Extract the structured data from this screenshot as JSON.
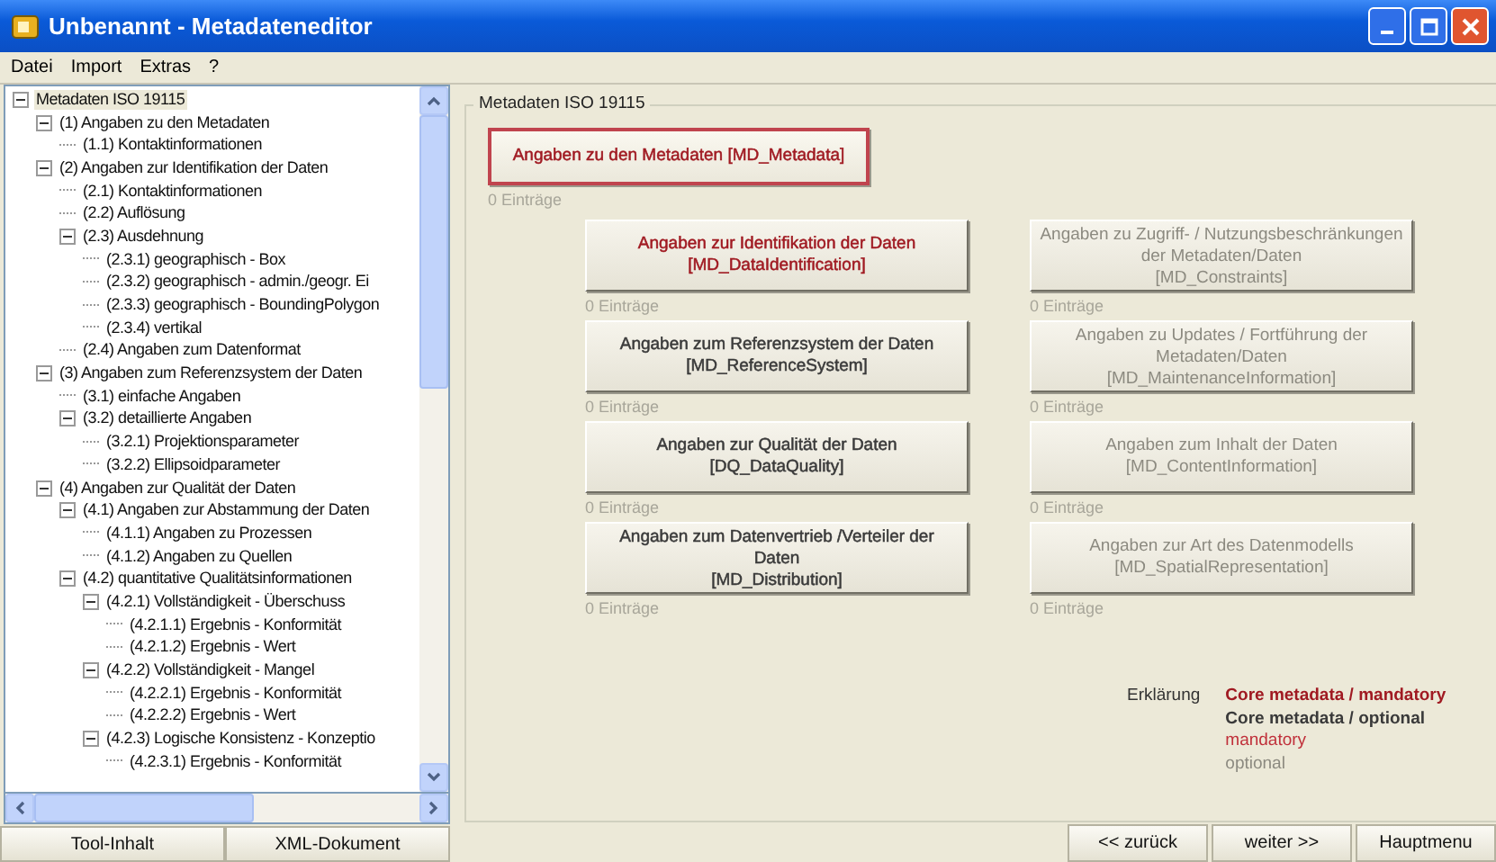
{
  "window": {
    "title": "Unbenannt - Metadateneditor"
  },
  "menu": [
    "Datei",
    "Import",
    "Extras",
    "?"
  ],
  "tree": [
    {
      "label": "Metadaten ISO 19115",
      "selected": true,
      "expanded": true,
      "children": [
        {
          "label": "(1) Angaben zu den Metadaten",
          "selected": false,
          "expanded": true,
          "children": [
            {
              "label": "(1.1) Kontaktinformationen",
              "selected": false
            }
          ]
        },
        {
          "label": "(2) Angaben zur Identifikation der Daten",
          "selected": false,
          "expanded": true,
          "children": [
            {
              "label": "(2.1) Kontaktinformationen",
              "selected": false
            },
            {
              "label": "(2.2) Auflösung",
              "selected": false
            },
            {
              "label": "(2.3) Ausdehnung",
              "selected": false,
              "expanded": true,
              "children": [
                {
                  "label": "(2.3.1) geographisch - Box",
                  "selected": false
                },
                {
                  "label": "(2.3.2) geographisch - admin./geogr. Ei",
                  "selected": false
                },
                {
                  "label": "(2.3.3) geographisch - BoundingPolygon",
                  "selected": false
                },
                {
                  "label": "(2.3.4) vertikal",
                  "selected": false
                }
              ]
            },
            {
              "label": "(2.4) Angaben zum Datenformat",
              "selected": false
            }
          ]
        },
        {
          "label": "(3) Angaben zum Referenzsystem der Daten",
          "selected": false,
          "expanded": true,
          "children": [
            {
              "label": "(3.1) einfache Angaben",
              "selected": false
            },
            {
              "label": "(3.2) detaillierte Angaben",
              "selected": false,
              "expanded": true,
              "children": [
                {
                  "label": "(3.2.1) Projektionsparameter",
                  "selected": false
                },
                {
                  "label": "(3.2.2) Ellipsoidparameter",
                  "selected": false
                }
              ]
            }
          ]
        },
        {
          "label": "(4) Angaben zur Qualität der Daten",
          "selected": false,
          "expanded": true,
          "children": [
            {
              "label": "(4.1) Angaben zur Abstammung der Daten",
              "selected": false,
              "expanded": true,
              "children": [
                {
                  "label": "(4.1.1) Angaben zu Prozessen",
                  "selected": false
                },
                {
                  "label": "(4.1.2) Angaben zu Quellen",
                  "selected": false
                }
              ]
            },
            {
              "label": "(4.2) quantitative Qualitätsinformationen",
              "selected": false,
              "expanded": true,
              "children": [
                {
                  "label": "(4.2.1) Vollständigkeit - Überschuss",
                  "selected": false,
                  "expanded": true,
                  "children": [
                    {
                      "label": "(4.2.1.1) Ergebnis - Konformität",
                      "selected": false
                    },
                    {
                      "label": "(4.2.1.2) Ergebnis - Wert",
                      "selected": false
                    }
                  ]
                },
                {
                  "label": "(4.2.2) Vollständigkeit - Mangel",
                  "selected": false,
                  "expanded": true,
                  "children": [
                    {
                      "label": "(4.2.2.1) Ergebnis - Konformität",
                      "selected": false
                    },
                    {
                      "label": "(4.2.2.2) Ergebnis - Wert",
                      "selected": false
                    }
                  ]
                },
                {
                  "label": "(4.2.3) Logische Konsistenz - Konzeptio",
                  "selected": false,
                  "expanded": true,
                  "children": [
                    {
                      "label": "(4.2.3.1) Ergebnis - Konformität",
                      "selected": false
                    }
                  ]
                }
              ]
            }
          ]
        }
      ]
    }
  ],
  "left_buttons": [
    "Tool-Inhalt",
    "XML-Dokument"
  ],
  "group": {
    "title": "Metadaten ISO 19115",
    "main": {
      "lines": [
        "Angaben zu den Metadaten [MD_Metadata]"
      ],
      "kind": "core_mandatory",
      "focused": true,
      "count": "0 Einträge"
    },
    "sections": [
      {
        "lines": [
          "Angaben zur Identifikation der Daten",
          "[MD_DataIdentification]"
        ],
        "kind": "core_mandatory",
        "count": "0 Einträge"
      },
      {
        "lines": [
          "Angaben zu Zugriff- / Nutzungsbeschränkungen",
          "der Metadaten/Daten",
          "[MD_Constraints]"
        ],
        "kind": "optional",
        "count": "0 Einträge"
      },
      {
        "lines": [
          "Angaben zum Referenzsystem der Daten",
          "[MD_ReferenceSystem]"
        ],
        "kind": "core_optional",
        "count": "0 Einträge"
      },
      {
        "lines": [
          "Angaben zu Updates / Fortführung der",
          "Metadaten/Daten",
          "[MD_MaintenanceInformation]"
        ],
        "kind": "optional",
        "count": "0 Einträge"
      },
      {
        "lines": [
          "Angaben zur Qualität der Daten",
          "[DQ_DataQuality]"
        ],
        "kind": "core_optional",
        "count": "0 Einträge"
      },
      {
        "lines": [
          "Angaben zum Inhalt der Daten",
          "[MD_ContentInformation]"
        ],
        "kind": "optional",
        "count": "0 Einträge"
      },
      {
        "lines": [
          "Angaben zum Datenvertrieb /Verteiler der",
          "Daten",
          "[MD_Distribution]"
        ],
        "kind": "core_optional",
        "count": "0 Einträge"
      },
      {
        "lines": [
          "Angaben zur Art des Datenmodells",
          "[MD_SpatialRepresentation]"
        ],
        "kind": "optional",
        "count": "0 Einträge"
      }
    ],
    "legend": {
      "label": "Erklärung",
      "items": [
        {
          "text": "Core metadata / mandatory",
          "kind": "core_mandatory"
        },
        {
          "text": "Core metadata / optional",
          "kind": "core_optional"
        },
        {
          "text": "mandatory",
          "kind": "mandatory"
        },
        {
          "text": "optional",
          "kind": "optional"
        }
      ]
    }
  },
  "nav_buttons": [
    "<< zurück",
    "weiter >>",
    "Hauptmenu"
  ]
}
